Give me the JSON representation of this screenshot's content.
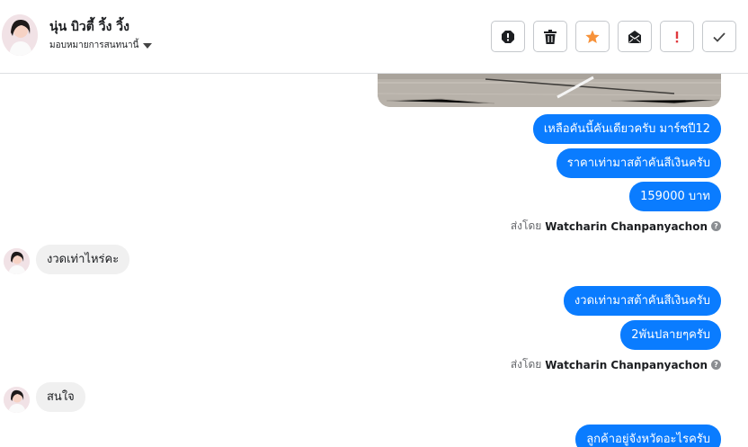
{
  "header": {
    "contact_name": "นุ่น บิวตี้ วิ้ง วิ้ง",
    "assign_label": "มอบหมายการสนทนานี้"
  },
  "toolbar": {
    "icons": [
      "alert-icon",
      "trash-icon",
      "star-icon",
      "envelope-icon",
      "exclamation-icon",
      "check-icon"
    ],
    "star_color": "#f7923a",
    "exclamation_color": "#e0393e"
  },
  "colors": {
    "outgoing_bubble": "#0a7cff",
    "incoming_bubble": "#f0f0f0"
  },
  "conversation": {
    "out_group_1": [
      "เหลือคันนี้คันเดียวครับ มาร์ชปี12",
      "ราคาเท่ามาสต้าคันสีเงินครับ",
      "159000 บาท"
    ],
    "sent_by_prefix_1": "ส่งโดย",
    "sent_by_name_1": "Watcharin Chanpanyachon",
    "in_1": "งวดเท่าไหร่คะ",
    "out_group_2": [
      "งวดเท่ามาสต้าคันสีเงินครับ",
      "2พันปลายๆครับ"
    ],
    "sent_by_prefix_2": "ส่งโดย",
    "sent_by_name_2": "Watcharin Chanpanyachon",
    "in_2": "สนใจ",
    "out_group_3": [
      "ลูกค้าอยู่จังหวัดอะไรครับ"
    ]
  }
}
